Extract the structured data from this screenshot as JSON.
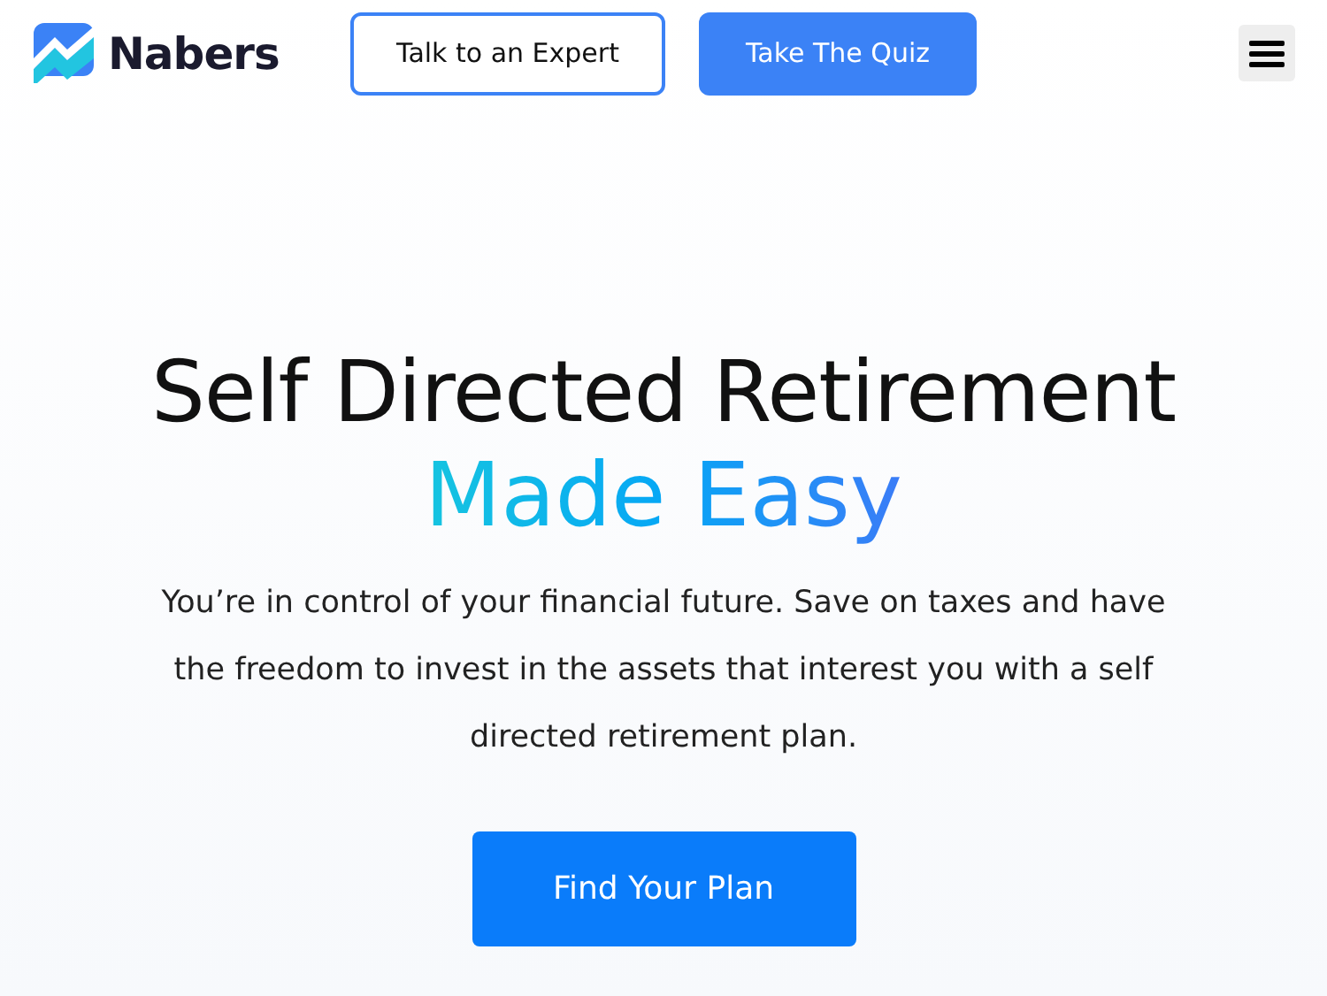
{
  "header": {
    "brand": "Nabers",
    "buttons": [
      {
        "label": "Talk to an Expert",
        "kind": "outline"
      },
      {
        "label": "Take The Quiz",
        "kind": "filled"
      }
    ]
  },
  "hero": {
    "title": "Self Directed Retirement",
    "highlight": "Made Easy",
    "text": "You’re in control of your financial future. Save on taxes and have the freedom to invest in the assets that interest you with a self directed retirement plan.",
    "cta": "Find Your Plan"
  }
}
